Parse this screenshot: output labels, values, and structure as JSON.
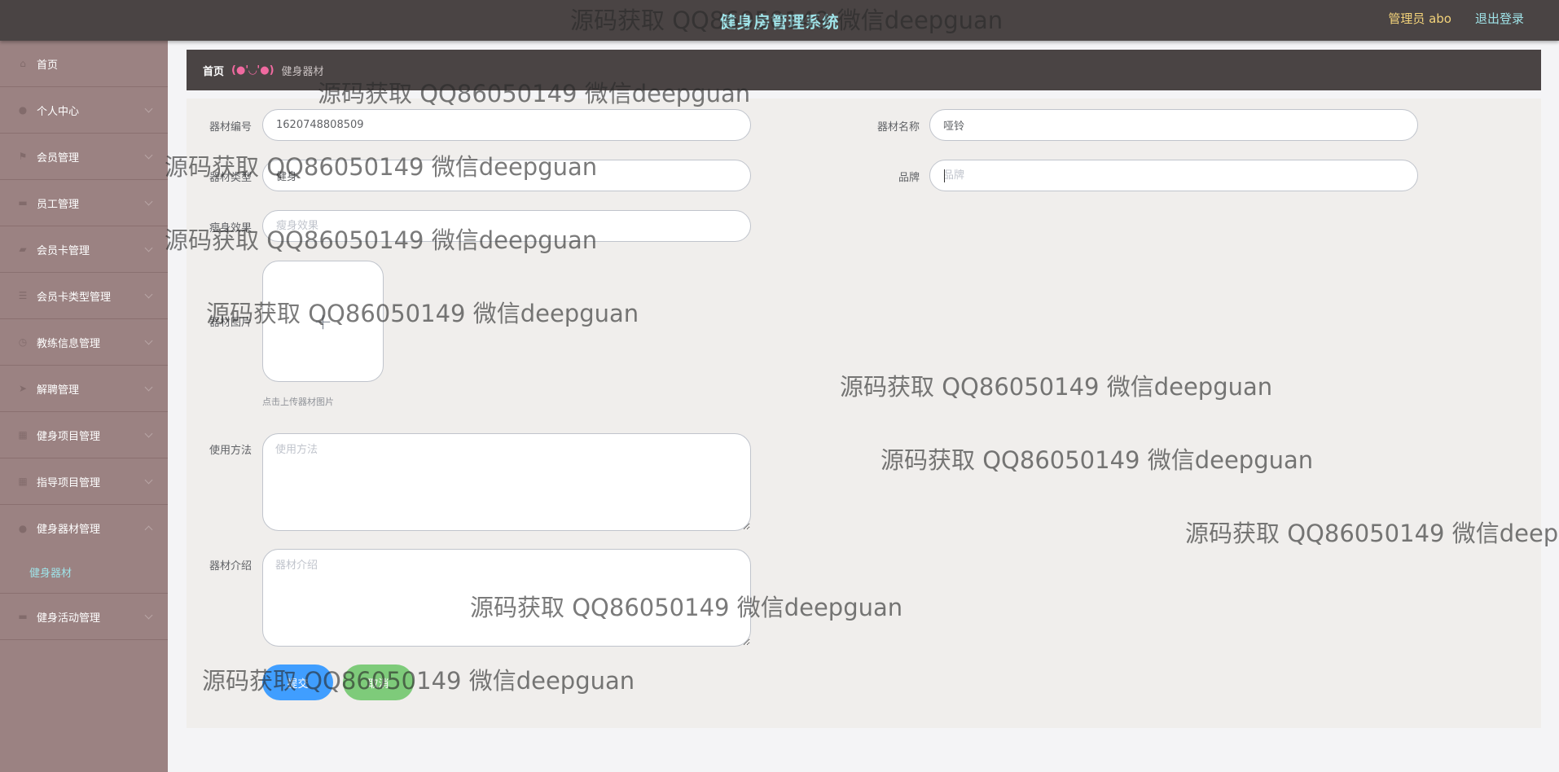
{
  "header": {
    "title": "健身房管理系统",
    "user_label": "管理员 abo",
    "logout_label": "退出登录"
  },
  "sidebar": {
    "items": [
      {
        "label": "首页",
        "icon": "home-icon"
      },
      {
        "label": "个人中心",
        "icon": "user-icon"
      },
      {
        "label": "会员管理",
        "icon": "flag-icon"
      },
      {
        "label": "员工管理",
        "icon": "chat-icon"
      },
      {
        "label": "会员卡管理",
        "icon": "card-icon"
      },
      {
        "label": "会员卡类型管理",
        "icon": "list-icon"
      },
      {
        "label": "教练信息管理",
        "icon": "clock-icon"
      },
      {
        "label": "解聘管理",
        "icon": "send-icon"
      },
      {
        "label": "健身项目管理",
        "icon": "grid-icon"
      },
      {
        "label": "指导项目管理",
        "icon": "grid-icon"
      },
      {
        "label": "健身器材管理",
        "icon": "person-icon"
      },
      {
        "label": "健身活动管理",
        "icon": "chat-icon"
      }
    ],
    "active_sub_item": "健身器材"
  },
  "breadcrumb": {
    "home": "首页",
    "separator": "(●'◡'●)",
    "current": "健身器材"
  },
  "form": {
    "equipment_no": {
      "label": "器材编号",
      "value": "1620748808509"
    },
    "equipment_name": {
      "label": "器材名称",
      "value": "哑铃"
    },
    "equipment_type": {
      "label": "器材类型",
      "value": "健身"
    },
    "brand": {
      "label": "品牌",
      "placeholder": "品牌"
    },
    "effect": {
      "label": "瘦身效果",
      "placeholder": "瘦身效果"
    },
    "image": {
      "label": "器材图片",
      "tip": "点击上传器材图片"
    },
    "usage": {
      "label": "使用方法",
      "placeholder": "使用方法"
    },
    "intro": {
      "label": "器材介绍",
      "placeholder": "器材介绍"
    },
    "submit_label": "提交",
    "cancel_label": "取消"
  },
  "watermark": "源码获取 QQ86050149 微信deepguan"
}
